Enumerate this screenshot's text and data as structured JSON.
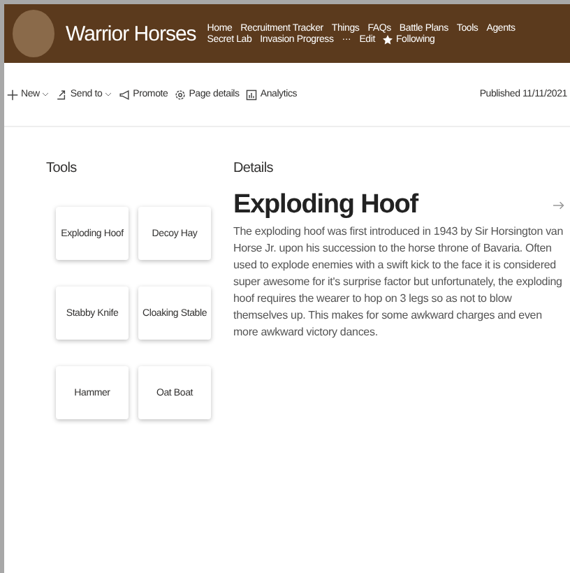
{
  "site": {
    "title": "Warrior Horses"
  },
  "nav": [
    {
      "label": "Home"
    },
    {
      "label": "Recruitment Tracker"
    },
    {
      "label": "Things"
    },
    {
      "label": "FAQs"
    },
    {
      "label": "Battle Plans"
    },
    {
      "label": "Tools"
    },
    {
      "label": "Agents"
    },
    {
      "label": "Secret Lab"
    },
    {
      "label": "Invasion Progress"
    },
    {
      "label": "···"
    },
    {
      "label": "Edit"
    }
  ],
  "follow": {
    "label": "Following"
  },
  "toolbar": [
    {
      "label": "New",
      "kind": "new",
      "dropdown": true
    },
    {
      "label": "Send to",
      "kind": "send",
      "dropdown": true
    },
    {
      "label": "Promote",
      "kind": "promote",
      "dropdown": false
    },
    {
      "label": "Page details",
      "kind": "details",
      "dropdown": false
    },
    {
      "label": "Analytics",
      "kind": "analytics",
      "dropdown": false
    }
  ],
  "published": "Published 11/11/2021",
  "tools": {
    "heading": "Tools",
    "items": [
      {
        "label": "Exploding Hoof"
      },
      {
        "label": "Decoy Hay"
      },
      {
        "label": "Stabby Knife"
      },
      {
        "label": "Cloaking Stable"
      },
      {
        "label": "Hammer"
      },
      {
        "label": "Oat Boat"
      }
    ]
  },
  "details": {
    "heading": "Details",
    "title": "Exploding Hoof",
    "text": "The exploding hoof was first introduced in 1943 by Sir Horsington van Horse Jr. upon his succession to the horse throne of Bavaria. Often used to explode enemies with a swift kick to the face it is considered super awesome for it's surprise factor but unfortunately, the exploding hoof requires the wearer to hop on 3 legs so as not to blow themselves up. This makes for some awkward charges and even more awkward victory dances."
  }
}
